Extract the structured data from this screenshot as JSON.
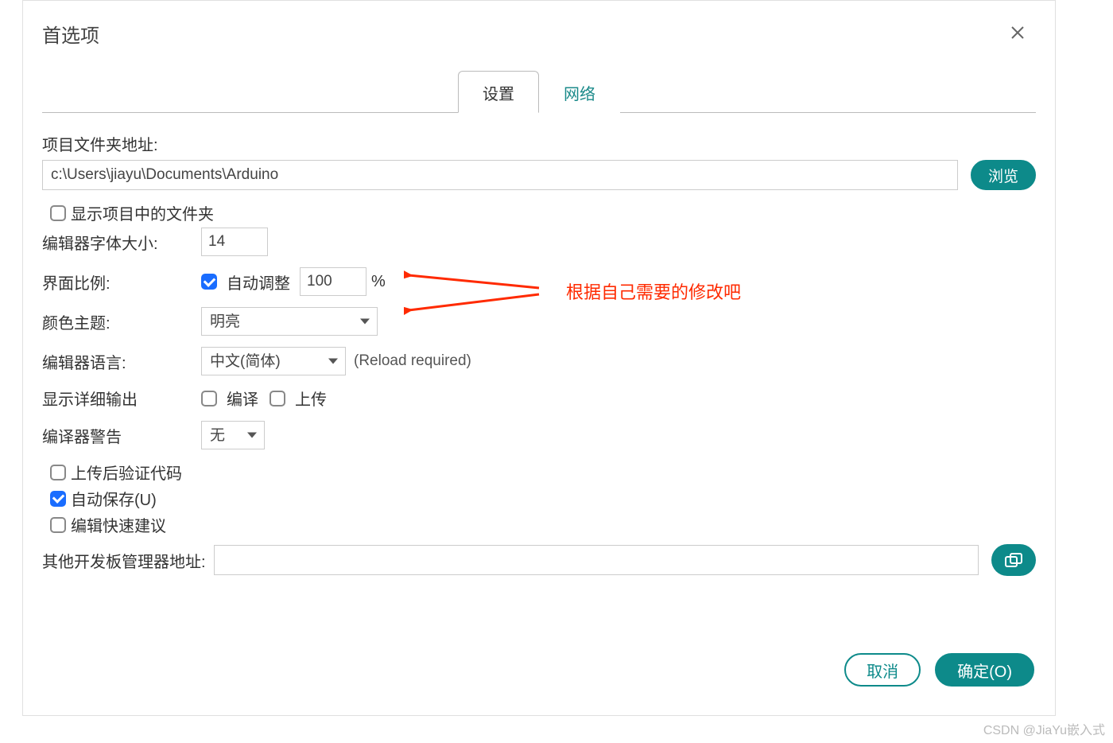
{
  "dialog": {
    "title": "首选项",
    "tabs": {
      "settings": "设置",
      "network": "网络"
    }
  },
  "fields": {
    "sketchbook_label": "项目文件夹地址:",
    "sketchbook_path": "c:\\Users\\jiayu\\Documents\\Arduino",
    "browse": "浏览",
    "show_files_in_sketch": "显示项目中的文件夹",
    "font_size_label": "编辑器字体大小:",
    "font_size_value": "14",
    "scale_label": "界面比例:",
    "scale_auto": "自动调整",
    "scale_value": "100",
    "scale_percent": "%",
    "theme_label": "颜色主题:",
    "theme_value": "明亮",
    "language_label": "编辑器语言:",
    "language_value": "中文(简体)",
    "reload_hint": "(Reload required)",
    "verbose_label": "显示详细输出",
    "verbose_compile": "编译",
    "verbose_upload": "上传",
    "warnings_label": "编译器警告",
    "warnings_value": "无",
    "verify_after_upload": "上传后验证代码",
    "autosave": "自动保存(U)",
    "quick_suggestions": "编辑快速建议",
    "boards_url_label": "其他开发板管理器地址:",
    "boards_url_value": ""
  },
  "buttons": {
    "cancel": "取消",
    "ok": "确定(O)"
  },
  "annotation": {
    "text": "根据自己需要的修改吧"
  },
  "watermark": "CSDN @JiaYu嵌入式"
}
